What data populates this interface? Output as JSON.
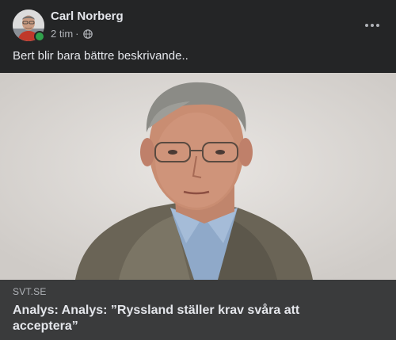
{
  "post": {
    "author": "Carl Norberg",
    "timestamp": "2 tim",
    "separator": "·",
    "audience_icon": "globe-icon",
    "more_icon": "more-options-icon",
    "text": "Bert blir bara bättre beskrivande..",
    "online": true
  },
  "link_preview": {
    "domain": "SVT.SE",
    "title": "Analys: Analys: ”Ryssland ställer krav svåra att acceptera”"
  },
  "colors": {
    "background": "#242526",
    "link_info_bg": "#3a3b3c",
    "primary_text": "#e4e6eb",
    "secondary_text": "#b0b3b8",
    "online": "#31a24c"
  }
}
